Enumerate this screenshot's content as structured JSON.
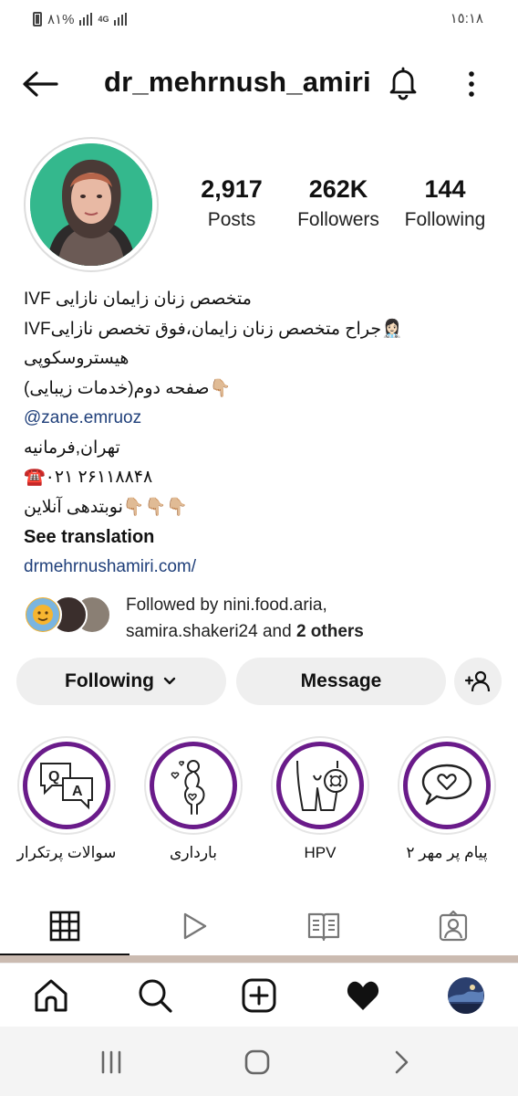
{
  "status_bar": {
    "battery_percent": "٨١%",
    "network": "4G",
    "time": "١٥:١٨"
  },
  "header": {
    "username": "dr_mehrnush_amiri",
    "icons": {
      "back": "back-arrow-icon",
      "notifications": "bell-icon",
      "more": "kebab-menu-icon"
    }
  },
  "profile": {
    "stats": [
      {
        "value": "2,917",
        "label": "Posts"
      },
      {
        "value": "262K",
        "label": "Followers"
      },
      {
        "value": "144",
        "label": "Following"
      }
    ],
    "bio": {
      "line1": "IVF متخصص زنان زایمان نازایی",
      "line2": "IVFجراح متخصص زنان زایمان،فوق تخصص نازایی👩🏻‍⚕️",
      "line3": "هیستروسکوپی",
      "line4": "👇🏼صفحه دوم(خدمات زیبایی)",
      "line5": "@zane.emruoz",
      "line6": "تهران,فرمانیه",
      "line7": "☎️۰۲۱ ۲۶۱۱۸۸۴۸",
      "line8": "👇🏼👇🏼👇🏼نوبتدهی آنلاین",
      "translate": "See translation",
      "website": "drmehrnushamiri.com/"
    },
    "followed_by": {
      "line1": "Followed by nini.food.aria,",
      "line2_prefix": "samira.shakeri24 and ",
      "line2_bold": "2 others"
    }
  },
  "actions": {
    "following_label": "Following",
    "message_label": "Message"
  },
  "highlights": [
    {
      "label": "سوالات پرتکرار",
      "icon": "qa-chat-icon"
    },
    {
      "label": "بارداری",
      "icon": "pregnancy-icon"
    },
    {
      "label": "HPV",
      "icon": "hpv-icon"
    },
    {
      "label": "پیام پر مهر ۲",
      "icon": "heart-chat-icon"
    }
  ],
  "tabs": [
    {
      "name": "posts-grid",
      "icon": "grid-icon",
      "active": true
    },
    {
      "name": "reels",
      "icon": "play-icon",
      "active": false
    },
    {
      "name": "guides",
      "icon": "guide-book-icon",
      "active": false
    },
    {
      "name": "tagged",
      "icon": "tagged-user-icon",
      "active": false
    }
  ],
  "bottom_nav": [
    {
      "name": "home",
      "icon": "home-icon"
    },
    {
      "name": "search",
      "icon": "search-icon"
    },
    {
      "name": "create",
      "icon": "plus-square-icon"
    },
    {
      "name": "activity",
      "icon": "heart-icon"
    },
    {
      "name": "profile",
      "icon": "profile-avatar-icon"
    }
  ],
  "colors": {
    "highlight_ring": "#6a1b8a",
    "link": "#1f3f7a",
    "button_bg": "#efefef",
    "avatar_bg": "#34b88d"
  }
}
